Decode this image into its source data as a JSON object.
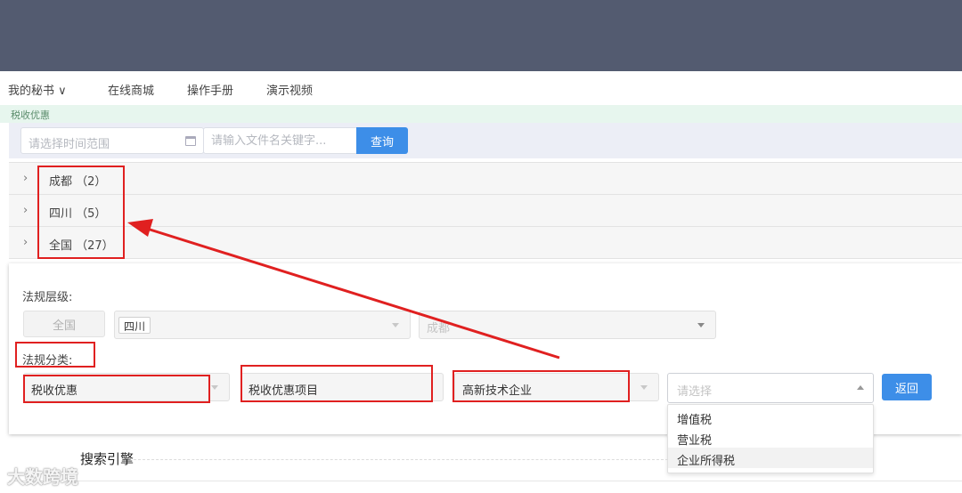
{
  "nav": {
    "items": [
      {
        "label": "我的秘书 ∨"
      },
      {
        "label": "在线商城"
      },
      {
        "label": "操作手册"
      },
      {
        "label": "演示视频"
      }
    ]
  },
  "breadcrumb": "税收优惠",
  "search": {
    "date_placeholder": "请选择时间范围",
    "keyword_placeholder": "请输入文件名关键字...",
    "query_label": "查询"
  },
  "accordion": [
    {
      "label": "成都 （2）"
    },
    {
      "label": "四川 （5）"
    },
    {
      "label": "全国 （27）"
    }
  ],
  "filters": {
    "level_label": "法规层级:",
    "all_button": "全国",
    "province_tag": "四川",
    "city_placeholder": "成都",
    "category_label": "法规分类:",
    "category_1": "税收优惠",
    "category_2": "税收优惠项目",
    "category_3": "高新技术企业",
    "category_4_placeholder": "请选择",
    "back_label": "返回",
    "options": [
      "增值税",
      "营业税",
      "企业所得税"
    ],
    "highlighted_option_index": 2
  },
  "section_title": "搜索引擎",
  "watermark": "大数跨境",
  "colors": {
    "topbar": "#535b70",
    "primary": "#3d8ee8",
    "annotation": "#e02020"
  }
}
